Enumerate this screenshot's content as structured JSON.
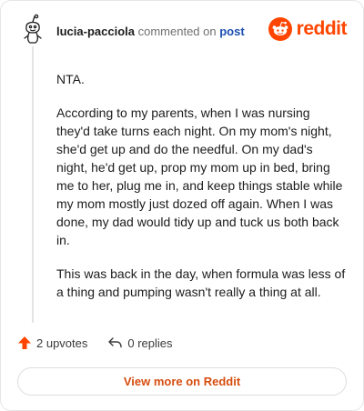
{
  "header": {
    "username": "lucia-pacciola",
    "action_text": "commented on",
    "link_text": "post"
  },
  "brand": {
    "wordmark": "reddit",
    "color": "#ff4500"
  },
  "comment": {
    "paragraphs": [
      "NTA.",
      "According to my parents, when I was nursing they'd take turns each night. On my mom's night, she'd get up and do the needful. On my dad's night, he'd get up, prop my mom up in bed, bring me to her, plug me in, and keep things stable while my mom mostly just dozed off again. When I was done, my dad would tidy up and tuck us both back in.",
      "This was back in the day, when formula was less of a thing and pumping wasn't really a thing at all."
    ]
  },
  "footer": {
    "upvotes_label": "2 upvotes",
    "replies_label": "0 replies",
    "upvote_icon": "upvote-arrow-icon",
    "reply_icon": "reply-arrow-icon"
  },
  "cta": {
    "label": "View more on Reddit",
    "color": "#d64d0e"
  }
}
